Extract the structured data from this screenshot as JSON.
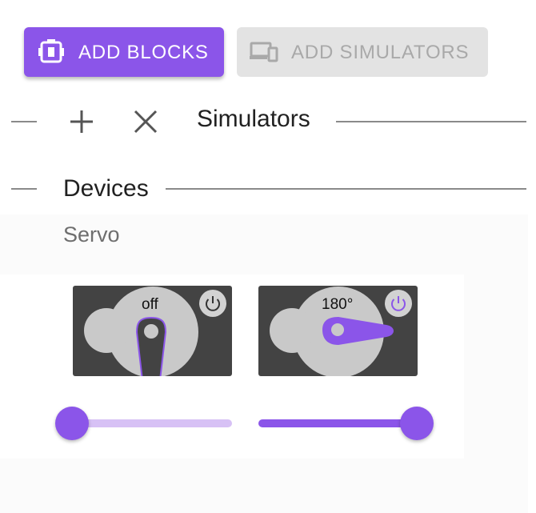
{
  "toolbar": {
    "add_blocks_label": "ADD BLOCKS",
    "add_simulators_label": "ADD SIMULATORS",
    "accent_color": "#8b55e9",
    "disabled_color": "#e3e3e3"
  },
  "simulators_section": {
    "title": "Simulators",
    "add_icon": "plus-icon",
    "close_icon": "close-icon"
  },
  "devices_section": {
    "title": "Devices",
    "device_name": "Servo"
  },
  "servos": [
    {
      "angle_label": "off",
      "power": "off",
      "slider_value_percent": 0
    },
    {
      "angle_label": "180°",
      "power": "on",
      "slider_value_percent": 100
    }
  ]
}
